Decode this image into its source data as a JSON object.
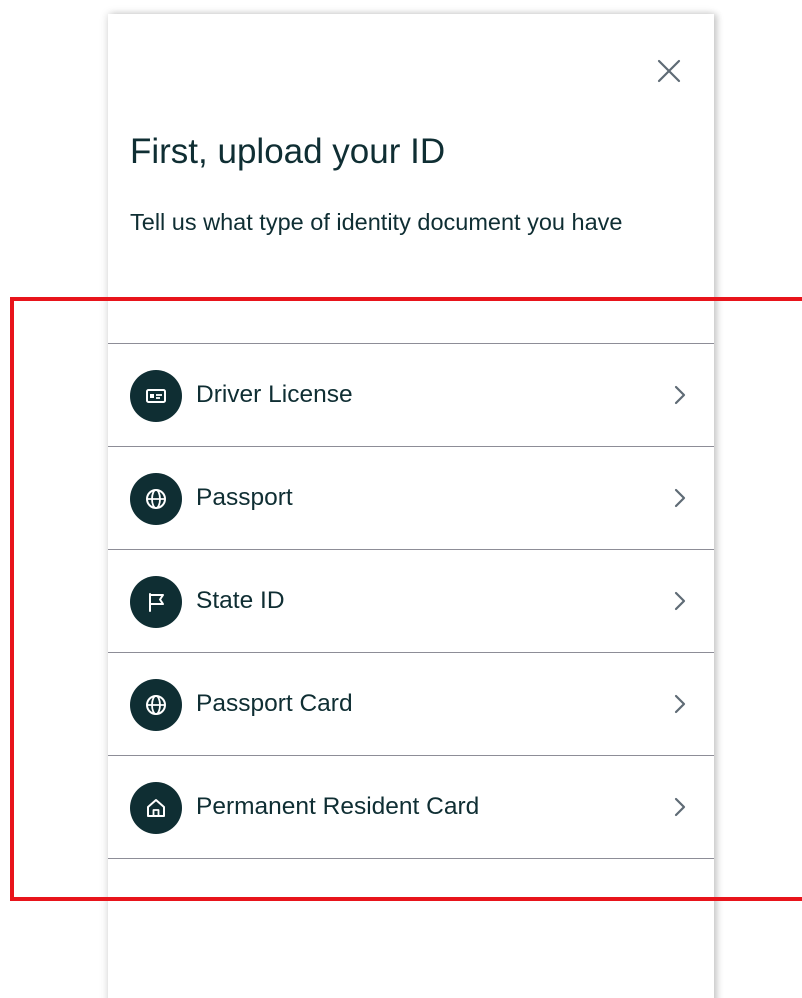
{
  "dialog": {
    "title": "First, upload your ID",
    "subtitle": "Tell us what type of identity document you have",
    "close_icon": "close-icon"
  },
  "id_options": [
    {
      "label": "Driver License",
      "icon": "id-card-icon"
    },
    {
      "label": "Passport",
      "icon": "globe-icon"
    },
    {
      "label": "State ID",
      "icon": "flag-icon"
    },
    {
      "label": "Passport Card",
      "icon": "globe-icon"
    },
    {
      "label": "Permanent Resident Card",
      "icon": "home-icon"
    }
  ],
  "colors": {
    "text": "#0f2e33",
    "icon_background": "#0f2e33",
    "divider": "#8d8d97",
    "highlight": "#e8141b"
  }
}
